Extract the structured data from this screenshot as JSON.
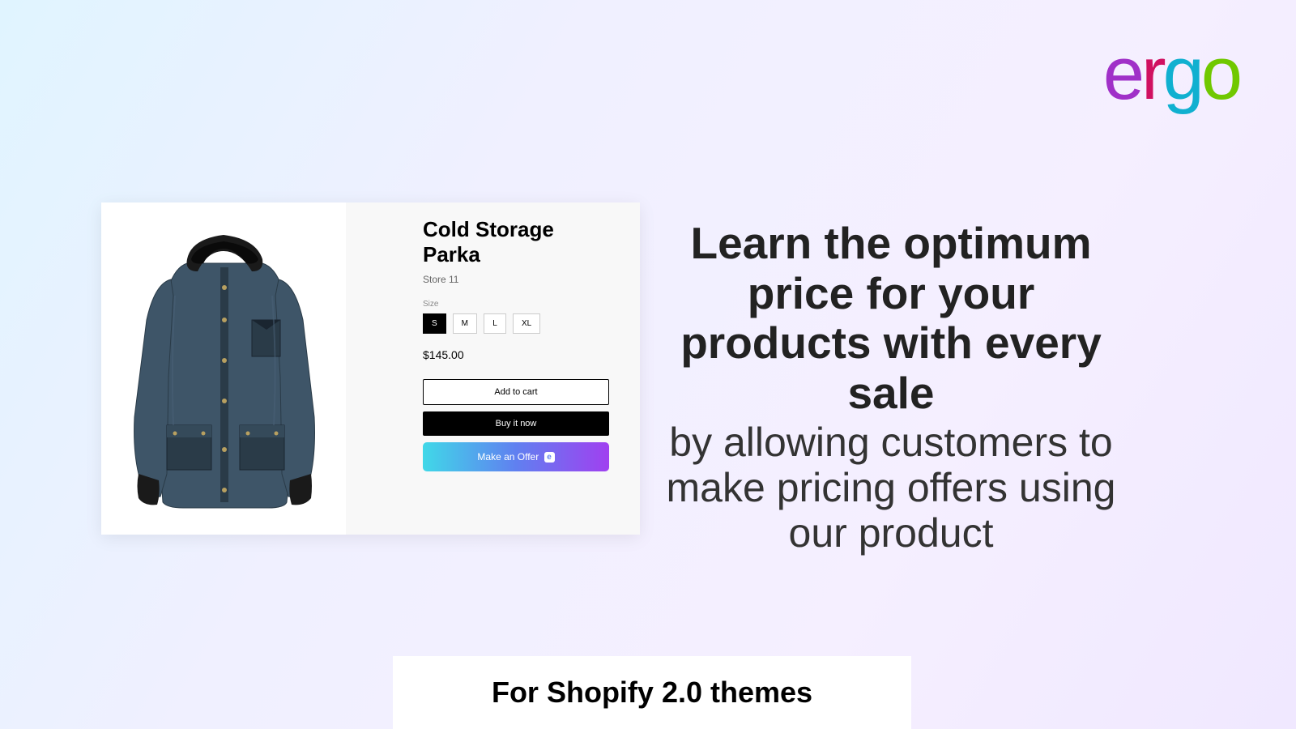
{
  "logo": {
    "e": "e",
    "r": "r",
    "g": "g",
    "o": "o"
  },
  "product": {
    "title": "Cold Storage Parka",
    "store": "Store 11",
    "size_label": "Size",
    "sizes": {
      "s": "S",
      "m": "M",
      "l": "L",
      "xl": "XL"
    },
    "price": "$145.00",
    "add_to_cart": "Add to cart",
    "buy_now": "Buy it now",
    "make_offer": "Make an Offer",
    "offer_icon": "e"
  },
  "headline": {
    "bold": "Learn the optimum price for your products with every sale",
    "regular": "by allowing customers to make pricing offers using our product"
  },
  "footer": "For Shopify 2.0 themes"
}
